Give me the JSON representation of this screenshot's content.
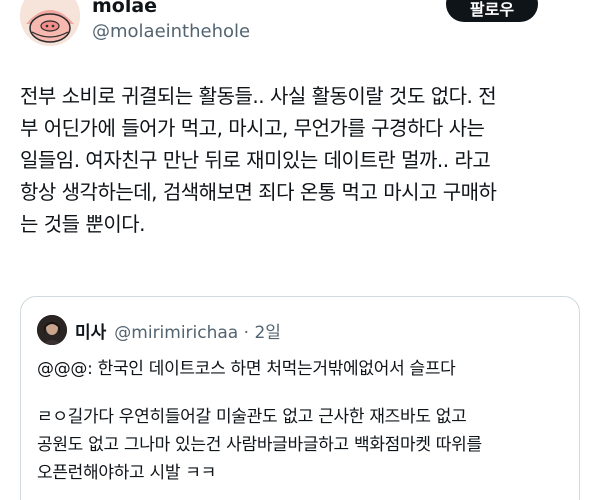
{
  "author": {
    "display_name": "molae",
    "handle": "@molaeinthehole",
    "follow_label": "팔로우",
    "avatar_icon": "pig-cartoon-avatar"
  },
  "tweet": {
    "lines": [
      "전부 소비로 귀결되는 활동들.. 사실 활동이랄 것도 없다. 전",
      "부 어딘가에 들어가 먹고, 마시고, 무언가를 구경하다 사는",
      "일들임. 여자친구 만난 뒤로 재미있는 데이트란 멀까.. 라고",
      "항상 생각하는데, 검색해보면 죄다 온통 먹고 마시고 구매하",
      "는 것들 뿐이다."
    ]
  },
  "quoted_tweet": {
    "display_name": "미사",
    "handle_and_time": "@mirimirichaa · 2일",
    "avatar_icon": "user-photo-avatar",
    "first_line": "@@@: 한국인 데이트코스 하면 처먹는거밖에없어서 슬프다",
    "lines": [
      "ㄹㅇ길가다 우연히들어갈 미술관도 없고 근사한 재즈바도 없고",
      "공원도 없고 그나마 있는건 사람바글바글하고 백화점마켓 따위를",
      "오픈런해야하고 시발 ㅋㅋ"
    ]
  }
}
